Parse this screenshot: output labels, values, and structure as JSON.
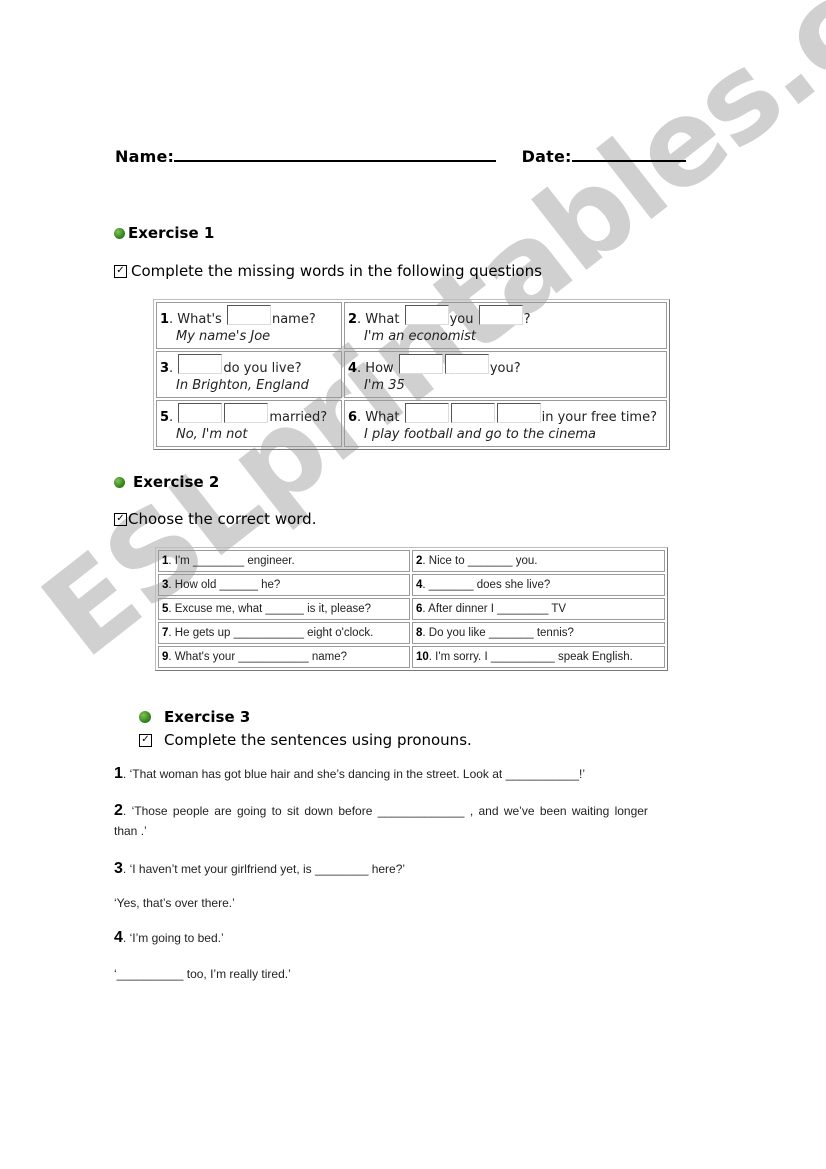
{
  "header": {
    "name_label": "Name:",
    "date_label": "Date:"
  },
  "exercise1": {
    "title": "Exercise 1",
    "instruction": "Complete the missing words in the following questions",
    "items": [
      {
        "num": "1",
        "before": ". What's",
        "after": "name?",
        "answer": "My name's Joe",
        "blanks": 1
      },
      {
        "num": "2",
        "before": ". What",
        "middle": "you",
        "after": "?",
        "answer": "I'm an economist",
        "blanks": 2
      },
      {
        "num": "3",
        "before": ".",
        "after": "do you live?",
        "answer": "In Brighton, England",
        "blanks": 1
      },
      {
        "num": "4",
        "before": ". How",
        "after": "you?",
        "answer": "I'm 35",
        "blanks": 2
      },
      {
        "num": "5",
        "before": ".",
        "after": "married?",
        "answer": "No, I'm not",
        "blanks": 2
      },
      {
        "num": "6",
        "before": ". What",
        "after": "in your free time?",
        "answer": "I play football and go to the cinema",
        "blanks": 3
      }
    ]
  },
  "exercise2": {
    "title": "Exercise 2",
    "instruction": "Choose the correct word.",
    "items": [
      {
        "num": "1",
        "text": ". I'm ________ engineer."
      },
      {
        "num": "2",
        "text": ". Nice to _______ you."
      },
      {
        "num": "3",
        "text": ". How old ______ he?"
      },
      {
        "num": "4",
        "text": ". _______ does she live?"
      },
      {
        "num": "5",
        "text": ". Excuse me, what ______ is it, please?"
      },
      {
        "num": "6",
        "text": ". After dinner I ________ TV"
      },
      {
        "num": "7",
        "text": ". He gets up ___________ eight o'clock."
      },
      {
        "num": "8",
        "text": ". Do you like _______ tennis?"
      },
      {
        "num": "9",
        "text": ". What's your ___________ name?"
      },
      {
        "num": "10",
        "text": ". I'm sorry. I __________ speak English."
      }
    ]
  },
  "exercise3": {
    "title": "Exercise 3",
    "instruction": "Complete the sentences using pronouns.",
    "items": [
      {
        "num": "1",
        "text": ". ‘That woman has got blue hair and she’s dancing in the street. Look at ___________!’"
      },
      {
        "num": "2",
        "text": ". ‘Those people are going to sit down before _____________ , and we’ve been waiting longer",
        "cont": "than .’"
      },
      {
        "num": "3",
        "text": ". ‘I haven’t met your girlfriend yet, is ________ here?’",
        "reply": "‘Yes, that’s over there.’"
      },
      {
        "num": "4",
        "text": ". ‘I’m going to bed.’",
        "reply": "‘__________ too, I’m really tired.’"
      }
    ]
  },
  "watermark": "ESLprintables.com"
}
